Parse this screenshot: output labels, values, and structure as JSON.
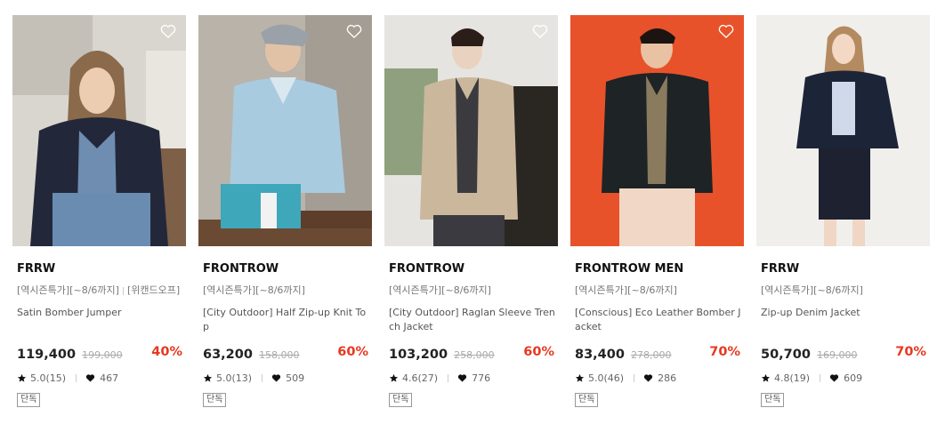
{
  "products": [
    {
      "brand": "FRRW",
      "promo": "[역시즌특가][~8/6까지]",
      "promo_extra": "[위캔드오프]",
      "name": "Satin Bomber Jumper",
      "price": "119,400",
      "original_price": "199,000",
      "discount": "40%",
      "rating": "5.0(15)",
      "likes": "467",
      "badge": "단독"
    },
    {
      "brand": "FRONTROW",
      "promo": "[역시즌특가][~8/6까지]",
      "name": "[City Outdoor] Half Zip-up Knit Top",
      "price": "63,200",
      "original_price": "158,000",
      "discount": "60%",
      "rating": "5.0(13)",
      "likes": "509",
      "badge": "단독"
    },
    {
      "brand": "FRONTROW",
      "promo": "[역시즌특가][~8/6까지]",
      "name": "[City Outdoor] Raglan Sleeve Trench Jacket",
      "price": "103,200",
      "original_price": "258,000",
      "discount": "60%",
      "rating": "4.6(27)",
      "likes": "776",
      "badge": "단독"
    },
    {
      "brand": "FRONTROW MEN",
      "promo": "[역시즌특가][~8/6까지]",
      "name": "[Conscious] Eco Leather Bomber Jacket",
      "price": "83,400",
      "original_price": "278,000",
      "discount": "70%",
      "rating": "5.0(46)",
      "likes": "286",
      "badge": "단독"
    },
    {
      "brand": "FRRW",
      "promo": "[역시즌특가][~8/6까지]",
      "name": "Zip-up Denim Jacket",
      "price": "50,700",
      "original_price": "169,000",
      "discount": "70%",
      "rating": "4.8(19)",
      "likes": "609",
      "badge": "단독"
    }
  ],
  "colors": {
    "discount": "#e8381f",
    "thumb_backgrounds": [
      "#d9d6d0",
      "#b9b3aa",
      "#e6e4e0",
      "#e8522a",
      "#f1efec"
    ]
  },
  "icons": {
    "wishlist": "heart-outline-icon",
    "rating": "star-icon",
    "likes": "heart-filled-icon"
  }
}
